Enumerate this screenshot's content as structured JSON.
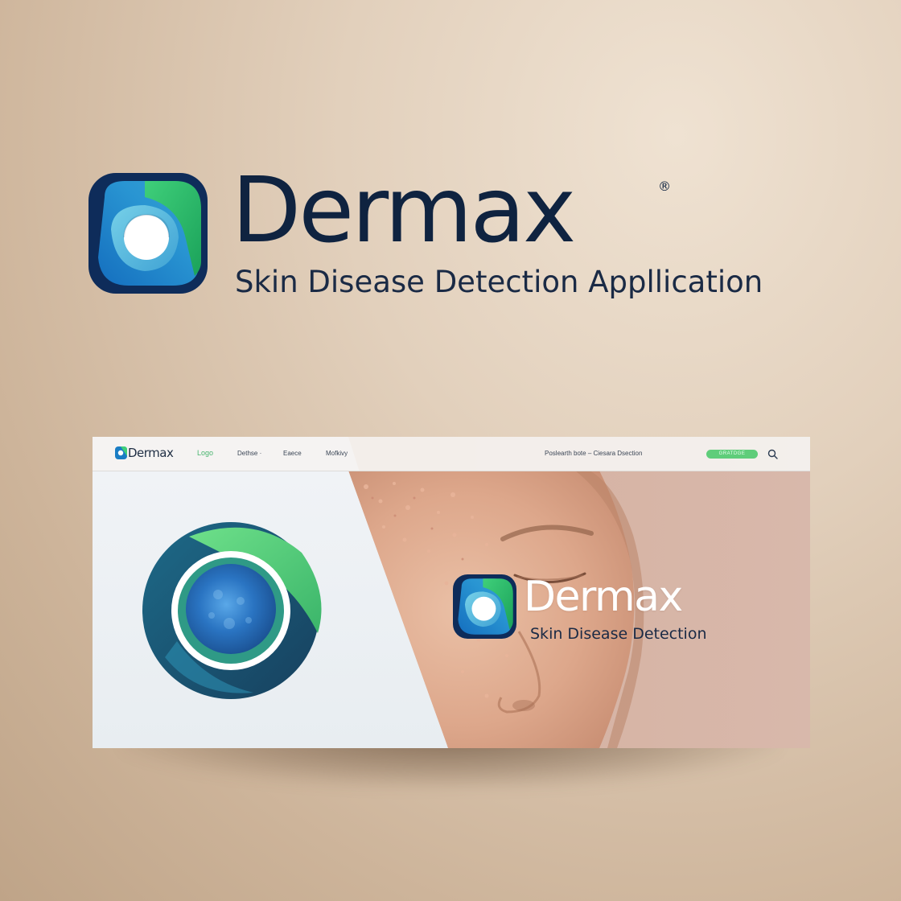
{
  "brand": {
    "name": "Dermax",
    "registered_mark": "®",
    "tagline": "Skin Disease Detection Appllication",
    "logo_icon": "dermax-logo-icon"
  },
  "mockup": {
    "nav": {
      "brand": "Dermax",
      "links": [
        "Logo",
        "Dethse ·",
        "Eaece",
        "Mofkivy"
      ],
      "right_text": "Poslearth bote – Ciesara Dsection",
      "cta_label": "GRATDGE",
      "search_icon": "search-icon"
    },
    "hero": {
      "emblem_icon": "cell-emblem-icon",
      "brand": "Dermax",
      "tagline": "Skin Disease Detection"
    }
  },
  "colors": {
    "navy": "#0f2340",
    "green": "#49b56f",
    "blue": "#1f7fc9",
    "teal": "#1e5f78",
    "background": "#e2d0bc"
  }
}
